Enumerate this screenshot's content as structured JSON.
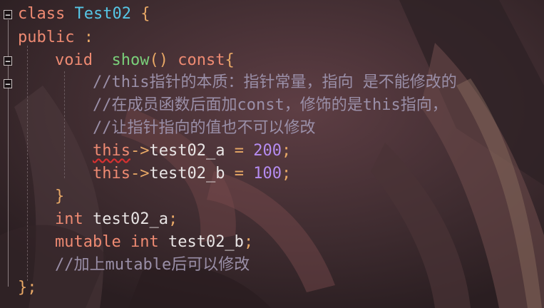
{
  "code": {
    "lines": [
      {
        "parts": [
          "class",
          " ",
          "Test02",
          " ",
          "{"
        ]
      },
      {
        "parts": [
          "public",
          " :"
        ]
      },
      {
        "parts": [
          "void",
          "  ",
          "show",
          "()",
          " ",
          "const",
          "{"
        ]
      },
      {
        "parts": [
          "//this指针的本质：指针常量，指向 是不能修改的"
        ]
      },
      {
        "parts": [
          "//在成员函数后面加const，修饰的是this指向，"
        ]
      },
      {
        "parts": [
          "//让指针指向的值也不可以修改"
        ]
      },
      {
        "parts": [
          "this",
          "->",
          "test02_a",
          " = ",
          "200",
          ";"
        ]
      },
      {
        "parts": [
          "this",
          "->",
          "test02_b",
          " = ",
          "100",
          ";"
        ]
      },
      {
        "parts": [
          "}"
        ]
      },
      {
        "parts": [
          "int",
          " test02_a",
          ";"
        ]
      },
      {
        "parts": [
          "mutable",
          " ",
          "int",
          " test02_b",
          ";"
        ]
      },
      {
        "parts": [
          "//加上mutable后可以修改"
        ]
      },
      {
        "parts": [
          "}",
          ";"
        ]
      }
    ]
  },
  "fold": {
    "symbol": "−"
  },
  "colors": {
    "keyword": "#ee8a72",
    "class_name": "#56c6e6",
    "function_name": "#7ad07a",
    "comment": "#9a8fa8",
    "identifier": "#e8e4e4",
    "number": "#b58cf0",
    "operator": "#e8a866"
  }
}
